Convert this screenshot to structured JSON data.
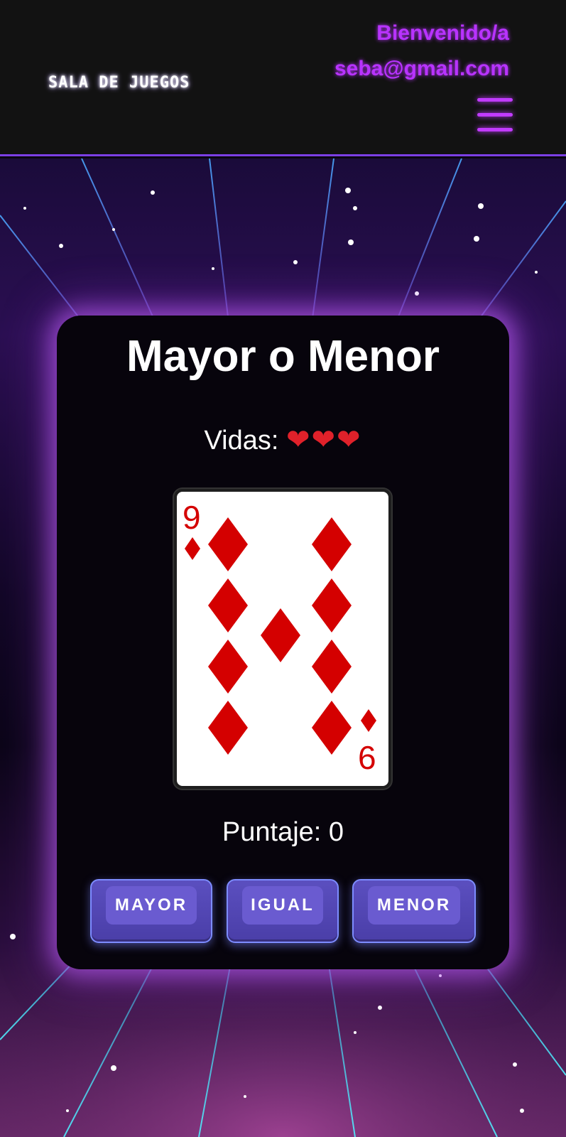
{
  "header": {
    "brand": "SALA DE JUEGOS",
    "welcome_line": "Bienvenido/a",
    "user_email": "seba@gmail.com",
    "menu_icon": "hamburger-menu-icon"
  },
  "game": {
    "title": "Mayor o Menor",
    "lives_label": "Vidas:",
    "hearts": "❤❤❤",
    "lives_count": 3,
    "card": {
      "rank_top": "9",
      "rank_bottom": "6",
      "suit": "diamonds",
      "suit_color": "#d40000"
    },
    "score_label": "Puntaje: 0",
    "buttons": {
      "higher": "MAYOR",
      "equal": "IGUAL",
      "lower": "MENOR"
    }
  },
  "colors": {
    "accent": "#b833ff",
    "button": "#5b4fbf",
    "panel": "#07040c"
  }
}
